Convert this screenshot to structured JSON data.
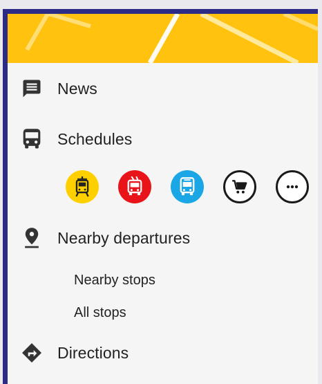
{
  "menu": {
    "news_label": "News",
    "schedules_label": "Schedules",
    "nearby_label": "Nearby departures",
    "nearby_stops_label": "Nearby stops",
    "all_stops_label": "All stops",
    "directions_label": "Directions"
  },
  "transport_modes": [
    {
      "icon": "tram-icon",
      "color": "#ffd000"
    },
    {
      "icon": "trolleybus-icon",
      "color": "#e8141a"
    },
    {
      "icon": "bus-icon",
      "color": "#1ba7e5"
    },
    {
      "icon": "shopping-cart-icon",
      "color": "#ffffff"
    },
    {
      "icon": "more-icon",
      "color": "#ffffff"
    }
  ],
  "colors": {
    "header": "#ffc20e",
    "frame": "#2c2c86",
    "drawer_bg": "#f5f5f5",
    "icon": "#333333"
  }
}
